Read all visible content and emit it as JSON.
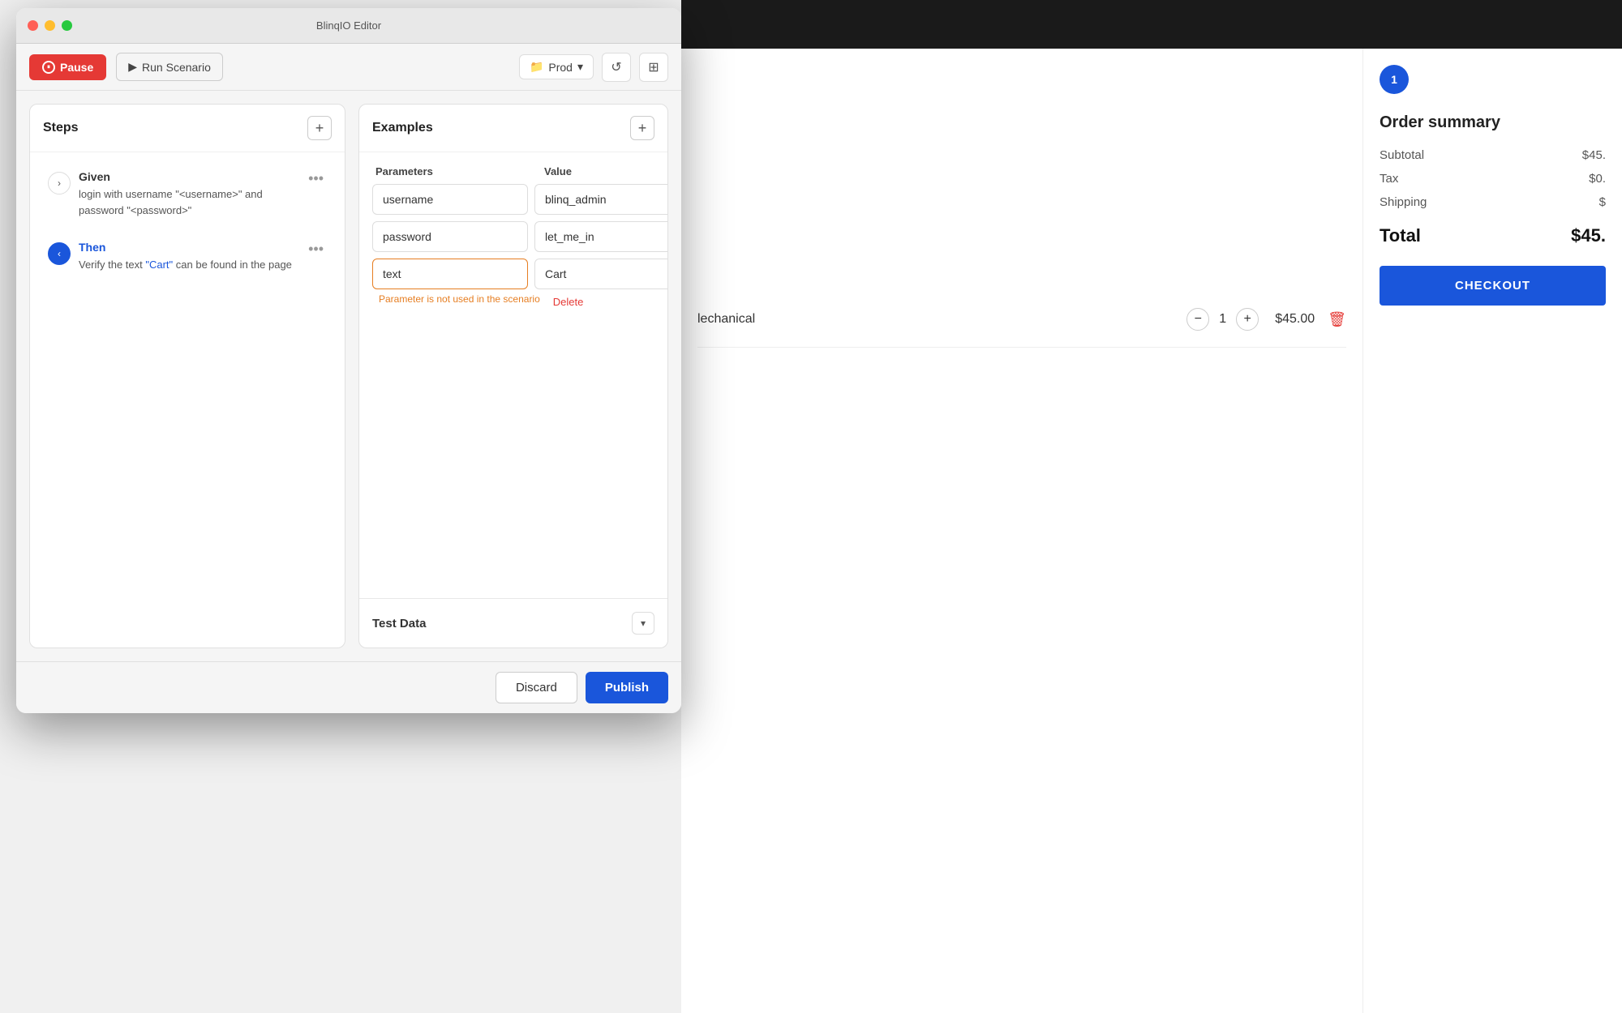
{
  "window": {
    "title": "BlinqIO Editor"
  },
  "toolbar": {
    "pause_label": "Pause",
    "run_label": "Run Scenario",
    "env_label": "Prod",
    "refresh_icon": "↺",
    "layout_icon": "⊞"
  },
  "steps": {
    "title": "Steps",
    "add_icon": "+",
    "items": [
      {
        "label": "Given",
        "type": "given",
        "description": "login with username \"<username>\" and password \"<password>\"",
        "expanded": false
      },
      {
        "label": "Then",
        "type": "then",
        "description_before": "Verify the text ",
        "link_text": "\"Cart\"",
        "description_after": " can be found in the page",
        "expanded": true
      }
    ]
  },
  "examples": {
    "title": "Examples",
    "add_icon": "+",
    "params_header": "Parameters",
    "value_header": "Value",
    "rows": [
      {
        "param": "username",
        "value": "blinq_admin",
        "has_error": false
      },
      {
        "param": "password",
        "value": "let_me_in",
        "has_error": false
      },
      {
        "param": "text",
        "value": "Cart",
        "has_error": true
      }
    ],
    "error_message": "Parameter is not used in the scenario",
    "delete_label": "Delete"
  },
  "test_data": {
    "title": "Test Data"
  },
  "actions": {
    "discard_label": "Discard",
    "publish_label": "Publish"
  },
  "bg_page": {
    "product_name": "lechanical",
    "quantity": "1",
    "price": "$45.00",
    "order_summary_title": "Order summary",
    "subtotal_label": "Subtotal",
    "subtotal_value": "$45.",
    "tax_label": "Tax",
    "tax_value": "$0.",
    "shipping_label": "Shipping",
    "shipping_value": "$",
    "total_label": "Total",
    "total_value": "$45.",
    "checkout_label": "CHECKOUT",
    "badge_num": "1"
  },
  "traffic_lights": {
    "red": "#ff5f56",
    "yellow": "#ffbd2e",
    "green": "#27c93f"
  }
}
